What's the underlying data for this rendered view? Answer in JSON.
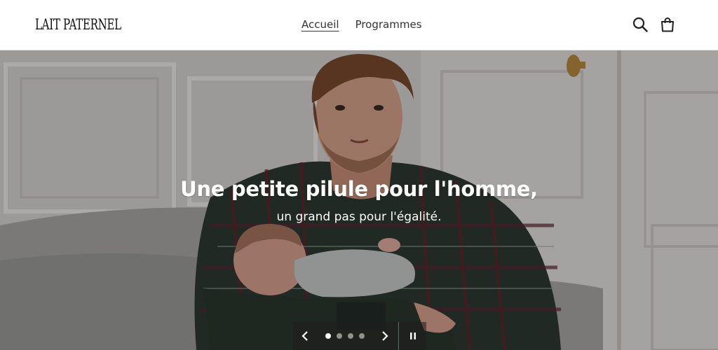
{
  "header": {
    "logo_text": "LAIT PATERNEL",
    "nav": [
      {
        "label": "Accueil",
        "active": true
      },
      {
        "label": "Programmes",
        "active": false
      }
    ],
    "icons": [
      "search-icon",
      "cart-icon"
    ]
  },
  "hero": {
    "heading": "Une petite pilule pour l'homme,",
    "subheading": "un grand pas pour l'égalité.",
    "slide_count": 4,
    "active_slide": 1,
    "controls": {
      "prev_icon": "chevron-left-icon",
      "next_icon": "chevron-right-icon",
      "pause_icon": "pause-icon"
    }
  },
  "colors": {
    "header_bg": "#ffffff",
    "text": "#333333",
    "hero_text": "#ffffff"
  }
}
